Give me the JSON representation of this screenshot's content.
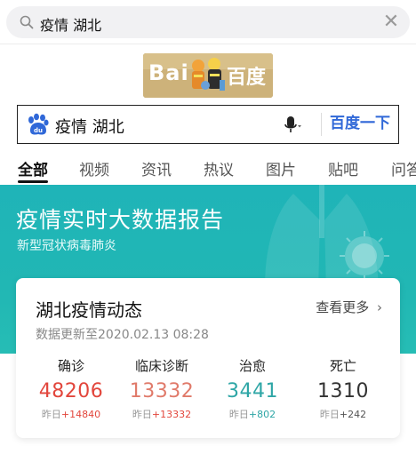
{
  "colors": {
    "accent_blue": "#3068d8",
    "banner_teal": "#21b7b4",
    "confirmed": "#e2463c",
    "clinical": "#e07a6a",
    "recovered": "#2ea6a6",
    "deaths": "#333333",
    "delta_red": "#e2463c",
    "delta_teal": "#2ea6a6"
  },
  "top_search": {
    "query": "疫情 湖北",
    "search_icon": "search-icon",
    "clear_icon": "close-icon"
  },
  "logo": {
    "left_text": "Bai",
    "right_text": "百度"
  },
  "search_box": {
    "query": "疫情 湖北",
    "submit_label": "百度一下",
    "mic_icon": "microphone-icon"
  },
  "tabs": [
    {
      "label": "全部",
      "active": true
    },
    {
      "label": "视频"
    },
    {
      "label": "资讯"
    },
    {
      "label": "热议"
    },
    {
      "label": "图片"
    },
    {
      "label": "贴吧"
    },
    {
      "label": "问答"
    }
  ],
  "banner": {
    "title": "疫情实时大数据报告",
    "subtitle": "新型冠状病毒肺炎"
  },
  "card": {
    "title": "湖北疫情动态",
    "more_label": "查看更多",
    "updated": "数据更新至2020.02.13 08:28",
    "stats": [
      {
        "label": "确诊",
        "value": "48206",
        "delta_prefix": "昨日",
        "delta": "+14840"
      },
      {
        "label": "临床诊断",
        "value": "13332",
        "delta_prefix": "昨日",
        "delta": "+13332"
      },
      {
        "label": "治愈",
        "value": "3441",
        "delta_prefix": "昨日",
        "delta": "+802"
      },
      {
        "label": "死亡",
        "value": "1310",
        "delta_prefix": "昨日",
        "delta": "+242"
      }
    ]
  }
}
